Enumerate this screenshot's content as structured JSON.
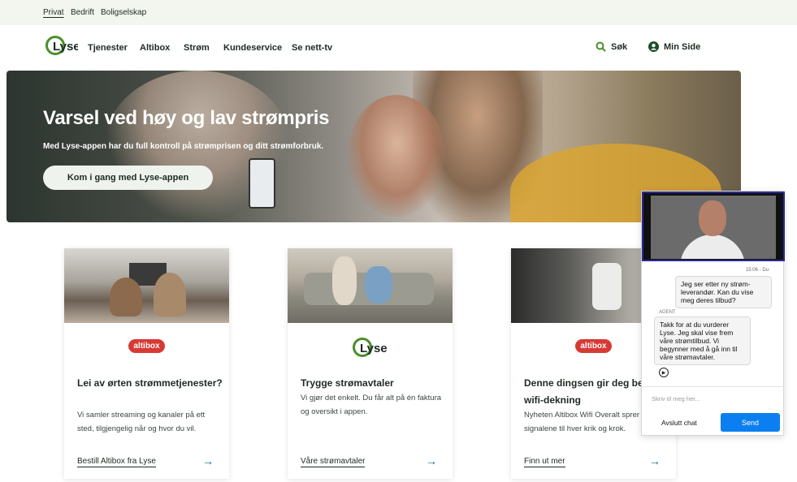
{
  "topbar": {
    "items": [
      "Privat",
      "Bedrift",
      "Boligselskap"
    ]
  },
  "header": {
    "logo_text": "Lyse",
    "nav": [
      "Tjenester",
      "Altibox",
      "Strøm",
      "Kundeservice",
      "Se nett-tv"
    ],
    "search_label": "Søk",
    "account_label": "Min Side"
  },
  "hero": {
    "title": "Varsel ved høy og lav strømpris",
    "subtitle": "Med Lyse-appen har du full kontroll på strømprisen og ditt strømforbruk.",
    "cta": "Kom i gang med Lyse-appen"
  },
  "cards": [
    {
      "brand": "altibox",
      "title": "Lei av ørten strømmetjenester?",
      "text": "Vi samler streaming og kanaler på ett sted, tilgjengelig når og hvor du vil.",
      "link": "Bestill Altibox fra Lyse"
    },
    {
      "brand": "Lyse",
      "title": "Trygge strømavtaler",
      "text": "Vi gjør det enkelt. Du får alt på én faktura og oversikt i appen.",
      "link": "Våre strømavtaler"
    },
    {
      "brand": "altibox",
      "title": "Denne dingsen gir deg bedre wifi-dekning",
      "text": "Nyheten Altibox Wifi Overalt sprer signalene til hver krik og krok.",
      "link": "Finn ut mer"
    }
  ],
  "chat": {
    "timestamp": "15:06 - Du",
    "user_message": "Jeg ser etter ny strøm-leverandør. Kan du vise meg deres tilbud?",
    "agent_label": "AGENT",
    "agent_message": "Takk for at du vurderer Lyse. Jeg skal vise frem våre strømtilbud. Vi begynner med å gå inn til våre strømavtaler.",
    "input_placeholder": "Skriv til meg her...",
    "end_label": "Avslutt chat",
    "send_label": "Send"
  },
  "colors": {
    "brand_green": "#4a8f2a",
    "dark_text": "#1d2b22",
    "link_arrow": "#0e6b85",
    "altibox_red": "#d73a35",
    "send_blue": "#0b7ff0"
  }
}
